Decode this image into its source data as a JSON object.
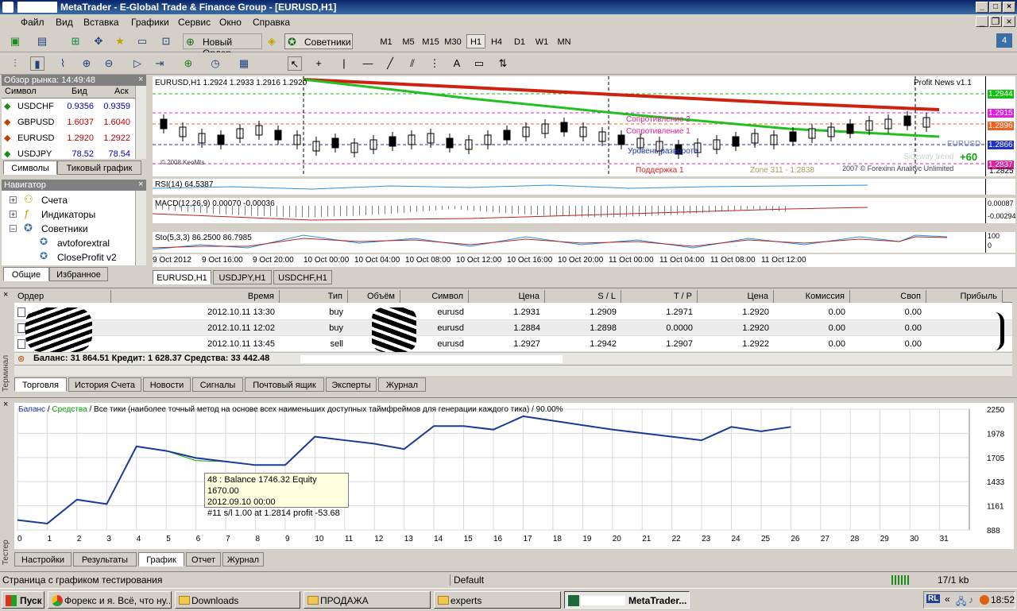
{
  "window": {
    "title": "MetaTrader - E-Global Trade & Finance Group - [EURUSD,H1]"
  },
  "menu": [
    "Файл",
    "Вид",
    "Вставка",
    "Графики",
    "Сервис",
    "Окно",
    "Справка"
  ],
  "toolbar": {
    "new_order": "Новый Ордер",
    "experts": "Советники",
    "timeframes": [
      "M1",
      "M5",
      "M15",
      "M30",
      "H1",
      "H4",
      "D1",
      "W1",
      "MN"
    ],
    "active_tf": "H1",
    "notify_count": "4"
  },
  "market_watch": {
    "title": "Обзор рынка: 14:49:48",
    "columns": [
      "Символ",
      "Бид",
      "Аск"
    ],
    "rows": [
      {
        "symbol": "USDCHF",
        "bid": "0.9356",
        "ask": "0.9359"
      },
      {
        "symbol": "GBPUSD",
        "bid": "1.6037",
        "ask": "1.6040"
      },
      {
        "symbol": "EURUSD",
        "bid": "1.2920",
        "ask": "1.2922"
      },
      {
        "symbol": "USDJPY",
        "bid": "78.52",
        "ask": "78.54"
      }
    ],
    "tabs": [
      "Символы",
      "Тиковый график"
    ]
  },
  "navigator": {
    "title": "Навигатор",
    "items": [
      "Счета",
      "Индикаторы",
      "Советники",
      "avtoforextral",
      "CloseProfit v2"
    ],
    "tabs": [
      "Общие",
      "Избранное"
    ]
  },
  "chart": {
    "header": "EURUSD,H1  1.2924 1.2933 1.2916 1.2920",
    "profit_news": "Profit News v1.1",
    "rsi_label": "RSI(14) 64.5387",
    "macd_label": "MACD(12,26,9) 0.00070 -0.00036",
    "sto_label": "Sto(5,3,3) 86.2500 86.7985",
    "resistance1": "Сопротивление 1",
    "resistance2": "Сопротивление 2",
    "pivot": "Уровень разворота",
    "support1": "Поддержка 1",
    "zone": "Zone 311 - 1.2838",
    "sideway": "Sideway trend",
    "plus60": "+60",
    "copyright": "2007 © Forexinn Analityc Unlimited",
    "copyright2": "© 2008 KeoMts",
    "sym_badge": "EURUSD",
    "price_labels": [
      "1.2944",
      "1.2915",
      "1.2896",
      "1.2866",
      "1.2837",
      "1.2825"
    ],
    "macd_scale": [
      "0.00087",
      "-0.00294"
    ],
    "sto_scale": [
      "100",
      "0"
    ],
    "time_labels": [
      "9 Oct 2012",
      "9 Oct 16:00",
      "9 Oct 20:00",
      "10 Oct 00:00",
      "10 Oct 04:00",
      "10 Oct 08:00",
      "10 Oct 12:00",
      "10 Oct 16:00",
      "10 Oct 20:00",
      "11 Oct 00:00",
      "11 Oct 04:00",
      "11 Oct 08:00",
      "11 Oct 12:00"
    ],
    "tabs": [
      "EURUSD,H1",
      "USDJPY,H1",
      "USDCHF,H1"
    ]
  },
  "terminal": {
    "columns": [
      "Ордер",
      "Время",
      "Тип",
      "Объём",
      "Символ",
      "Цена",
      "S / L",
      "T / P",
      "Цена",
      "Комиссия",
      "Своп",
      "Прибыль"
    ],
    "rows": [
      {
        "time": "2012.10.11 13:30",
        "type": "buy",
        "symbol": "eurusd",
        "price": "1.2931",
        "sl": "1.2909",
        "tp": "1.2971",
        "cur": "1.2920",
        "comm": "0.00",
        "swap": "0.00"
      },
      {
        "time": "2012.10.11 12:02",
        "type": "buy",
        "symbol": "eurusd",
        "price": "1.2884",
        "sl": "1.2898",
        "tp": "0.0000",
        "cur": "1.2920",
        "comm": "0.00",
        "swap": "0.00"
      },
      {
        "time": "2012.10.11 13:45",
        "type": "sell",
        "symbol": "eurusd",
        "price": "1.2927",
        "sl": "1.2942",
        "tp": "1.2907",
        "cur": "1.2922",
        "comm": "0.00",
        "swap": "0.00"
      }
    ],
    "balance": "Баланс: 31 864.51  Кредит: 1 628.37  Средства: 33 442.48",
    "tabs": [
      "Торговля",
      "История Счета",
      "Новости",
      "Сигналы",
      "Почтовый ящик",
      "Эксперты",
      "Журнал"
    ],
    "side_label": "Терминал"
  },
  "tester": {
    "legend_balance": "Баланс",
    "legend_equity": "Средства",
    "legend_rest": "/ Все тики (наиболее точный метод на основе всех наименьших доступных таймфреймов для генерации каждого тика) / 90.00%",
    "tooltip": [
      "48 : Balance 1746.32 Equity 1670.00",
      "2012.09.10 00:00",
      "#11 s/l 1.00 at 1.2814 profit -53.68"
    ],
    "tabs": [
      "Настройки",
      "Результаты",
      "График",
      "Отчет",
      "Журнал"
    ],
    "side_label": "Тестер"
  },
  "chart_data": {
    "type": "line",
    "x": [
      0,
      1,
      2,
      3,
      4,
      5,
      6,
      7,
      8,
      9,
      10,
      11,
      12,
      13,
      14,
      15,
      16,
      17,
      18,
      19,
      20,
      21,
      22,
      23,
      24,
      25,
      26
    ],
    "x_ticks": [
      0,
      1,
      2,
      3,
      4,
      5,
      6,
      7,
      8,
      9,
      10,
      11,
      12,
      13,
      14,
      15,
      16,
      17,
      18,
      19,
      20,
      21,
      22,
      23,
      24,
      25,
      26,
      27,
      28,
      29,
      30,
      31
    ],
    "series": [
      {
        "name": "Баланс",
        "values": [
          1000,
          960,
          1230,
          1180,
          1830,
          1780,
          1700,
          1660,
          1620,
          1620,
          1940,
          1900,
          1860,
          1800,
          2060,
          2060,
          2020,
          2170,
          2120,
          2070,
          2020,
          1980,
          1940,
          1900,
          2050,
          2000,
          2050
        ]
      },
      {
        "name": "Средства",
        "values": [
          1000,
          960,
          1230,
          1180,
          1830,
          1780,
          1670,
          1660,
          1620,
          1620,
          1940,
          1900,
          1860,
          1800,
          2060,
          2060,
          2020,
          2170,
          2120,
          2070,
          2020,
          1980,
          1940,
          1900,
          2050,
          2000,
          2050
        ]
      }
    ],
    "y_ticks": [
      888,
      1161,
      1433,
      1705,
      1978,
      2250
    ],
    "ylim": [
      888,
      2250
    ],
    "xlim": [
      0,
      32
    ]
  },
  "status": {
    "left": "Страница с графиком тестирования",
    "profile": "Default",
    "traffic": "17/1 kb"
  },
  "taskbar": {
    "start": "Пуск",
    "items": [
      "Форекс и я. Всё, что ну...",
      "Downloads",
      "ПРОДАЖА",
      "experts",
      "MetaTrader..."
    ],
    "lang": "RL",
    "clock": "18:52"
  }
}
